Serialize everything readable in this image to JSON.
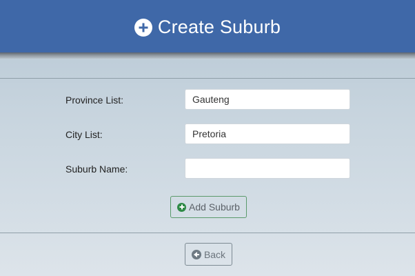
{
  "header": {
    "title": "Create Suburb",
    "icon": "plus-circle-icon",
    "color": "#3f68a8"
  },
  "form": {
    "province": {
      "label": "Province List:",
      "value": "Gauteng"
    },
    "city": {
      "label": "City List:",
      "value": "Pretoria"
    },
    "suburb": {
      "label": "Suburb Name:",
      "value": ""
    }
  },
  "buttons": {
    "add": {
      "label": "Add Suburb",
      "icon": "plus-circle-icon",
      "accent": "#2f8a47"
    },
    "back": {
      "label": "Back",
      "icon": "arrow-left-circle-icon"
    }
  }
}
